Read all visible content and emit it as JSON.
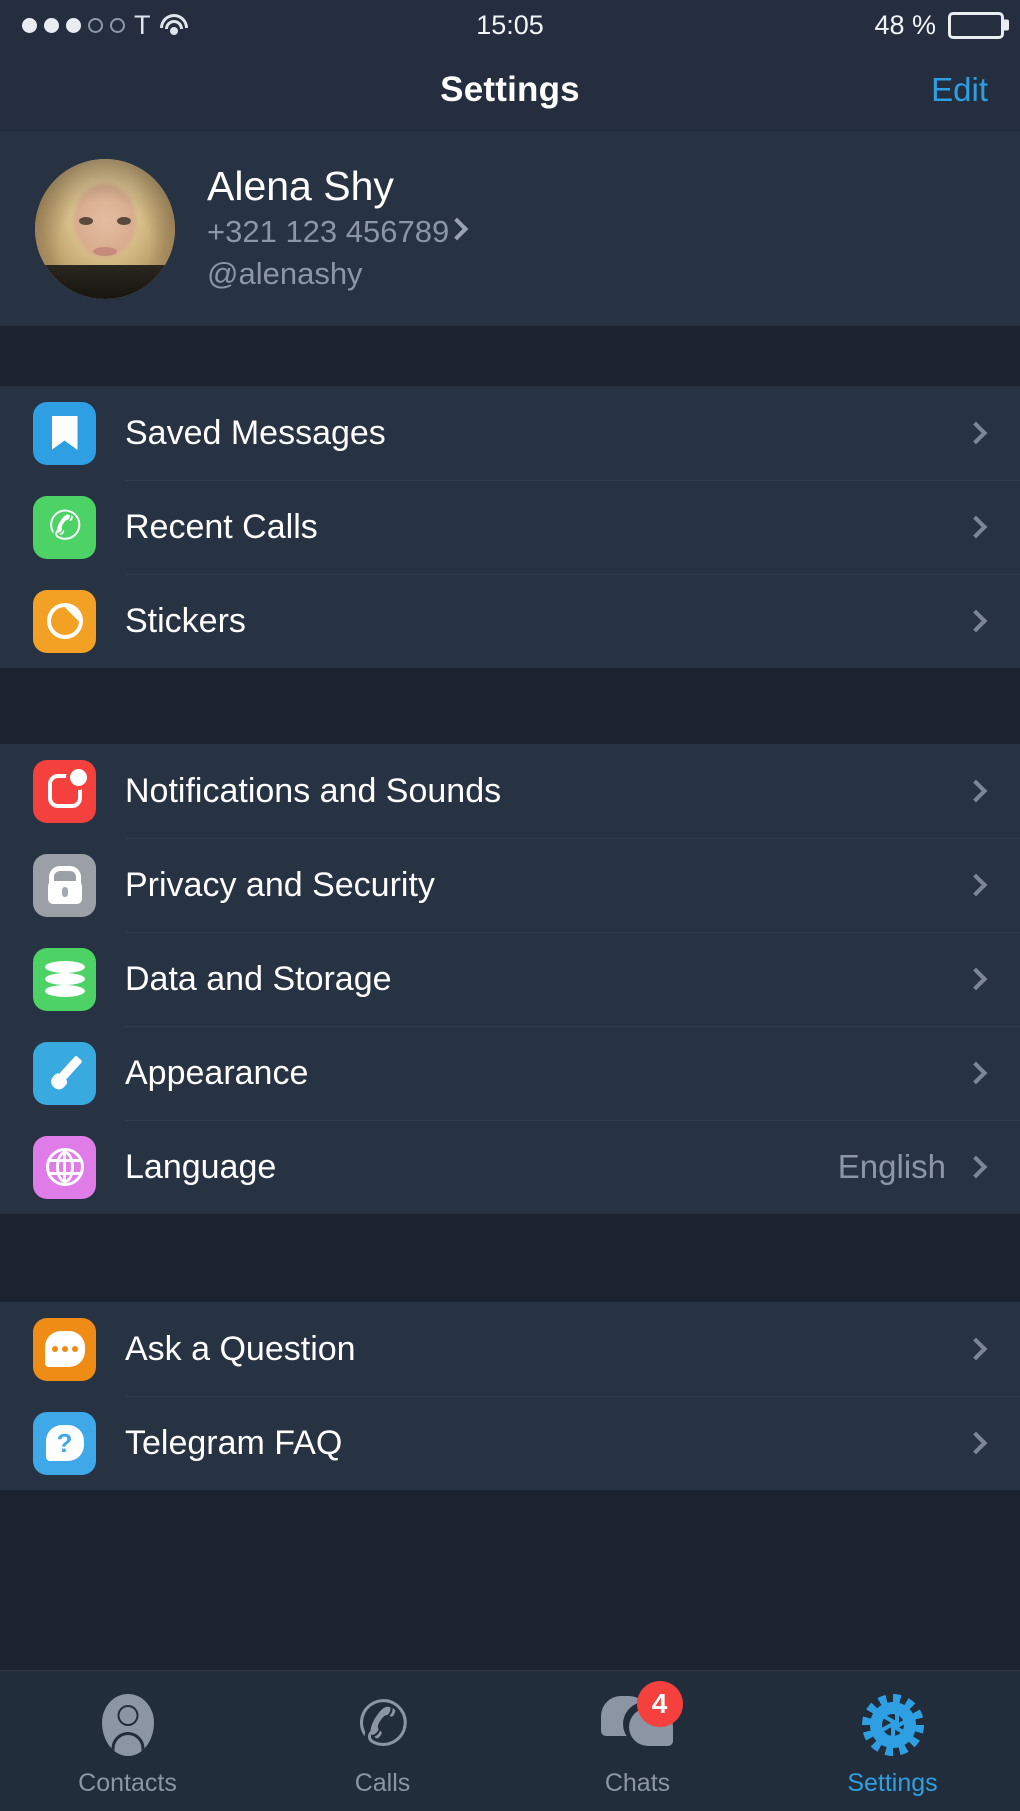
{
  "status_bar": {
    "signal_dots_filled": 3,
    "signal_dots_empty": 2,
    "carrier": "T",
    "wifi_icon": "wifi-icon",
    "time": "15:05",
    "battery_label": "48 %",
    "battery_percent": 48
  },
  "navbar": {
    "title": "Settings",
    "edit_label": "Edit"
  },
  "profile": {
    "name": "Alena Shy",
    "phone": "+321 123 456789",
    "username": "@alenashy",
    "avatar_name": "avatar"
  },
  "groups": [
    {
      "rows": [
        {
          "label": "Saved Messages",
          "icon": "bookmark-icon",
          "color": "#2f9fe3",
          "value": ""
        },
        {
          "label": "Recent Calls",
          "icon": "phone-icon",
          "color": "#4cd265",
          "value": ""
        },
        {
          "label": "Stickers",
          "icon": "sticker-icon",
          "color": "#f2a125",
          "value": ""
        }
      ]
    },
    {
      "rows": [
        {
          "label": "Notifications and Sounds",
          "icon": "notification-icon",
          "color": "#f4413d",
          "value": ""
        },
        {
          "label": "Privacy and Security",
          "icon": "lock-icon",
          "color": "#9aa0a6",
          "value": ""
        },
        {
          "label": "Data and Storage",
          "icon": "database-icon",
          "color": "#4cd265",
          "value": ""
        },
        {
          "label": "Appearance",
          "icon": "paintbrush-icon",
          "color": "#38aae0",
          "value": ""
        },
        {
          "label": "Language",
          "icon": "globe-icon",
          "color": "#df7ce8",
          "value": "English"
        }
      ]
    },
    {
      "rows": [
        {
          "label": "Ask a Question",
          "icon": "chat-bubble-icon",
          "color": "#ef8c16",
          "value": ""
        },
        {
          "label": "Telegram FAQ",
          "icon": "question-bubble-icon",
          "color": "#3fa8e8",
          "value": ""
        }
      ]
    }
  ],
  "tabbar": {
    "tabs": [
      {
        "label": "Contacts",
        "icon": "contact-icon",
        "active": false,
        "badge": ""
      },
      {
        "label": "Calls",
        "icon": "call-icon",
        "active": false,
        "badge": ""
      },
      {
        "label": "Chats",
        "icon": "chats-icon",
        "active": false,
        "badge": "4"
      },
      {
        "label": "Settings",
        "icon": "gear-icon",
        "active": true,
        "badge": ""
      }
    ]
  },
  "colors": {
    "accent": "#2f9fe3",
    "row_background": "#273243",
    "page_background": "#1b2230",
    "bar_background": "#242e3e",
    "badge_red": "#f4413d"
  }
}
